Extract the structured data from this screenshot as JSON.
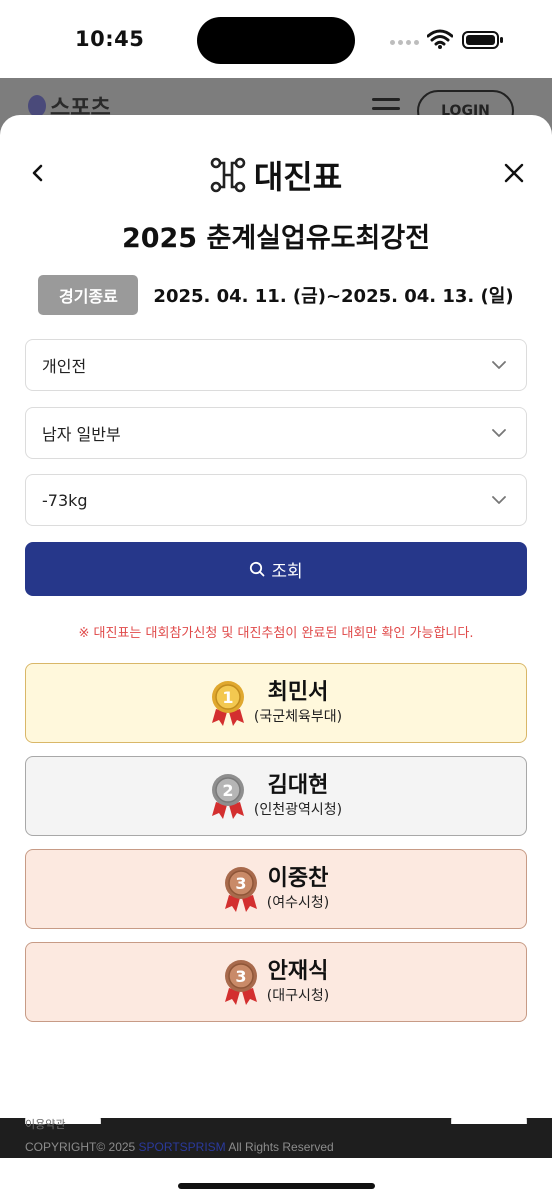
{
  "status_bar": {
    "time": "10:45"
  },
  "background_page": {
    "logo_text": "스포츠",
    "login_label": "LOGIN",
    "terms_text": "이용약관",
    "copyright_prefix": "COPYRIGHT© 2025 ",
    "copyright_brand": "SPORTSPRISM",
    "copyright_suffix": " All Rights Reserved"
  },
  "modal": {
    "title": "대진표",
    "event_title": "2025 춘계실업유도최강전",
    "status_badge": "경기종료",
    "date_range": "2025. 04. 11. (금)~2025. 04. 13. (일)",
    "filters": [
      {
        "selected": "개인전"
      },
      {
        "selected": "남자 일반부"
      },
      {
        "selected": "-73kg"
      }
    ],
    "search_label": "조회",
    "notice": "※ 대진표는 대회참가신청 및 대진추첨이 완료된 대회만 확인 가능합니다.",
    "results": [
      {
        "rank": "1",
        "name": "최민서",
        "team": "(국군체육부대)",
        "medal": "gold"
      },
      {
        "rank": "2",
        "name": "김대현",
        "team": "(인천광역시청)",
        "medal": "silver"
      },
      {
        "rank": "3",
        "name": "이중찬",
        "team": "(여수시청)",
        "medal": "bronze"
      },
      {
        "rank": "3",
        "name": "안재식",
        "team": "(대구시청)",
        "medal": "bronze"
      }
    ]
  },
  "colors": {
    "primary": "#26378a",
    "notice": "#e04b4b",
    "gold_card": "#fff8dc",
    "silver_card": "#f4f4f4",
    "bronze_card": "#fce9e0",
    "badge": "#9a9a9a"
  },
  "icons": {
    "back": "chevron-left-icon",
    "close": "close-icon",
    "bracket": "bracket-icon",
    "dropdown": "chevron-down-icon",
    "search": "search-icon",
    "medal": "medal-icon"
  }
}
